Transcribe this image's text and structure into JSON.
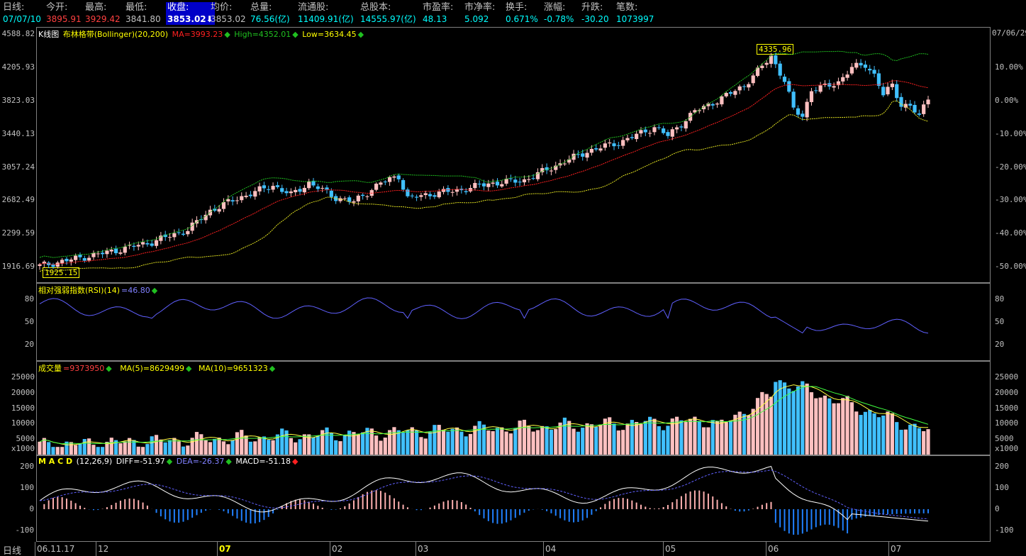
{
  "quote": {
    "fields": [
      {
        "label": "日线:",
        "value": "07/07/10",
        "color": "#00ffff"
      },
      {
        "label": "今开:",
        "value": "3895.91",
        "color": "#ff4040"
      },
      {
        "label": "最高:",
        "value": "3929.42",
        "color": "#ff4040"
      },
      {
        "label": "最低:",
        "value": "3841.80",
        "color": "#c0c0c0"
      },
      {
        "label": "收盘:",
        "value": "3853.02⬇",
        "color": "#ffffff",
        "highlight": true
      },
      {
        "label": "均价:",
        "value": "3853.02",
        "color": "#c0c0c0"
      },
      {
        "label": "总量:",
        "value": "76.56(亿)",
        "color": "#00ffff"
      },
      {
        "label": "流通股:",
        "value": "11409.91(亿)",
        "color": "#00ffff"
      },
      {
        "label": "总股本:",
        "value": "14555.97(亿)",
        "color": "#00ffff"
      },
      {
        "label": "市盈率:",
        "value": "48.13",
        "color": "#00ffff"
      },
      {
        "label": "市净率:",
        "value": "5.092",
        "color": "#00ffff"
      },
      {
        "label": "换手:",
        "value": "0.671%",
        "color": "#00ffff"
      },
      {
        "label": "涨幅:",
        "value": "-0.78%",
        "color": "#00ffff"
      },
      {
        "label": "升跌:",
        "value": "-30.20",
        "color": "#00ffff"
      },
      {
        "label": "笔数:",
        "value": "1073997",
        "color": "#00ffff"
      }
    ]
  },
  "kline": {
    "legend_title": "K线图",
    "legend_ind": "布林格带(Bollinger)(20,200)",
    "legend_ma": "MA=3993.23",
    "legend_high": "High=4352.01",
    "legend_low": "Low=3634.45",
    "price_labels": [
      "4588.82",
      "4205.93",
      "3823.03",
      "3440.13",
      "3057.24",
      "2682.49",
      "2299.59",
      "1916.69"
    ],
    "pct_labels": [
      "",
      "10.00%",
      "0.00%",
      "-10.00%",
      "-20.00%",
      "-30.00%",
      "-40.00%",
      "-50.00%"
    ],
    "corner_date": "07/06/29",
    "max_tag": "4335.96",
    "min_tag": "1925.15"
  },
  "rsi": {
    "legend": "相对强弱指数(RSI)(14)",
    "legend_val": "=46.80",
    "labels": [
      "80",
      "50",
      "20"
    ]
  },
  "volume": {
    "legend": "成交量",
    "legend_val": "=9373950",
    "legend_ma5": "MA(5)=8629499",
    "legend_ma10": "MA(10)=9651323",
    "labels": [
      "25000",
      "20000",
      "15000",
      "10000",
      "5000",
      "x1000"
    ]
  },
  "macd": {
    "legend": "M A C D",
    "legend_params": "(12,26,9)",
    "legend_diff": "DIFF=-51.97",
    "legend_dea": "DEA=-26.37",
    "legend_macd": "MACD=-51.18",
    "labels": [
      "200",
      "100",
      "0",
      "-100"
    ]
  },
  "status": {
    "label": "日线",
    "date_labels": [
      {
        "text": "06.11.17",
        "bold": false
      },
      {
        "text": "12",
        "bold": false
      },
      {
        "text": "07",
        "bold": true
      },
      {
        "text": "02",
        "bold": false
      },
      {
        "text": "03",
        "bold": false
      },
      {
        "text": "04",
        "bold": false
      },
      {
        "text": "05",
        "bold": false
      },
      {
        "text": "06",
        "bold": false
      },
      {
        "text": "07",
        "bold": false
      }
    ]
  },
  "colors": {
    "up": "#ffc0c0",
    "down": "#40c0ff",
    "boll_mid": "#ff2020",
    "boll_up": "#20c020",
    "boll_low": "#e0e020",
    "rsi": "#6060ff",
    "frame": "#808080"
  }
}
